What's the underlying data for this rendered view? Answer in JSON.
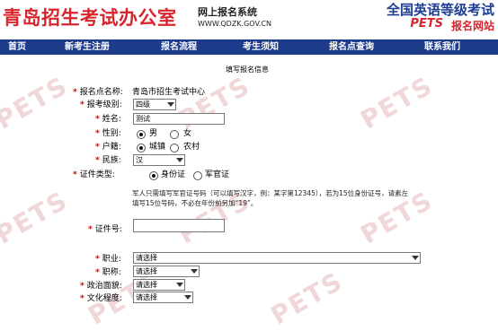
{
  "header": {
    "brand_title": "青岛招生考试办公室",
    "brand_subtitle": "网上报名系统",
    "brand_url": "WWW.QDZK.GOV.CN",
    "pets_title": "全国英语等级考试",
    "pets_en": "PETS",
    "pets_reg": "报名网站"
  },
  "nav": {
    "items": [
      "首页",
      "新考生注册",
      "报名流程",
      "考生须知",
      "报名点查询",
      "联系我们"
    ]
  },
  "form": {
    "title": "填写报名信息",
    "fields": {
      "exam_site": {
        "label": "报名点名称:",
        "value": "青岛市招生考试中心"
      },
      "exam_level": {
        "label": "报考级别:",
        "value": "四级"
      },
      "name": {
        "label": "姓名:",
        "value": "测试"
      },
      "gender": {
        "label": "性别:",
        "opt1": "男",
        "opt2": "女",
        "selected": "男"
      },
      "household": {
        "label": "户籍:",
        "opt1": "城镇",
        "opt2": "农村",
        "selected": "城镇"
      },
      "ethnicity": {
        "label": "民族:",
        "value": "汉"
      },
      "id_type": {
        "label": "证件类型:",
        "opt1": "身份证",
        "opt2": "军官证",
        "selected": "身份证"
      },
      "id_note": "军人只需填写军官证号码（可以填写汉字，例：某字第12345），若为15位身份证号，请素左填写15位号码，不必在年份前另加“19”。",
      "id_number": {
        "label": "证件号:",
        "value": ""
      },
      "occupation": {
        "label": "职业:",
        "value": "请选择"
      },
      "title_rank": {
        "label": "职称:",
        "value": "请选择"
      },
      "political": {
        "label": "政治面貌:",
        "value": "请选择"
      },
      "education": {
        "label": "文化程度:",
        "value": "请选择"
      }
    }
  },
  "watermark": "PETS",
  "colors": {
    "brand_red": "#d8262e",
    "nav_blue": "#1e3c8c",
    "required_star": "#d40000"
  }
}
